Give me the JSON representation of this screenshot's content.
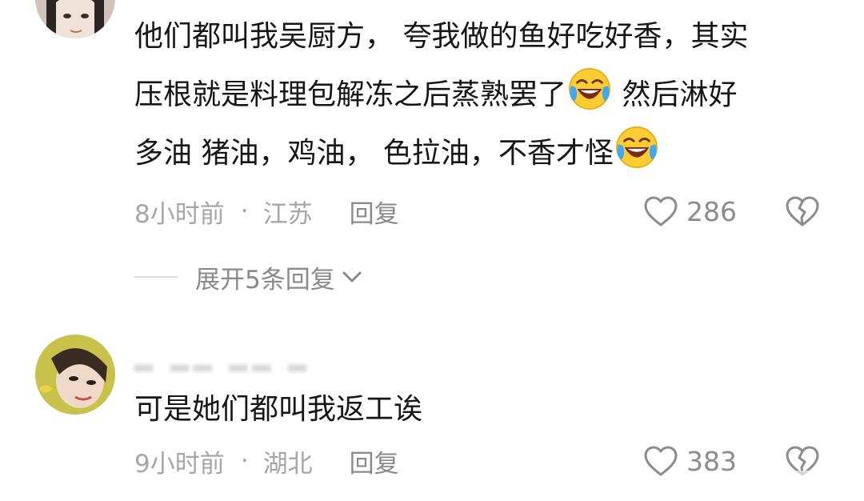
{
  "comments": [
    {
      "text_line1": "他们都叫我吴厨方， 夸我做的鱼好吃好香，其实",
      "text_line2_before": "压根就是料理包解冻之后蒸熟罢了",
      "text_line2_after": " 然后淋好",
      "text_line3": "多油 猪油，鸡油， 色拉油，不香才怪",
      "emoji_icon": "laughing-crying-emoji",
      "time": "8小时前",
      "separator": "·",
      "location": "江苏",
      "reply_label": "回复",
      "like_count": "286",
      "expand_label": "展开5条回复"
    },
    {
      "text": "可是她们都叫我返工诶",
      "time": "9小时前",
      "separator": "·",
      "location": "湖北",
      "reply_label": "回复",
      "like_count": "383"
    }
  ],
  "colors": {
    "text": "#161616",
    "meta": "#a6a6a6",
    "icon": "#8c8c8c"
  }
}
